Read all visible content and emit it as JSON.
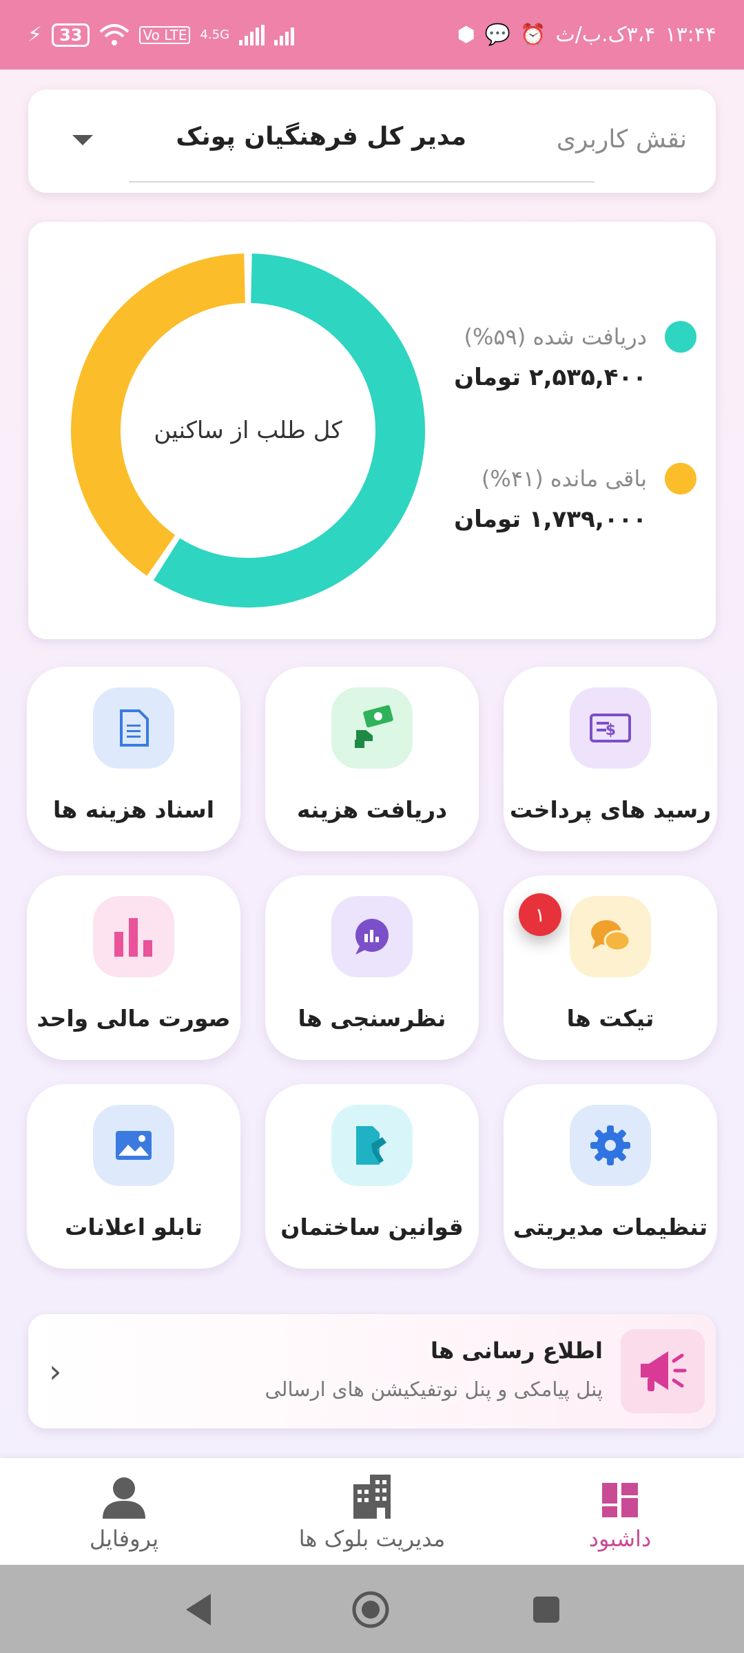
{
  "status_bar": {
    "time": "۱۳:۴۴",
    "date": "۳،۴ک.ب/ث",
    "battery": "33",
    "network": "4.5G",
    "volte": "Vo LTE"
  },
  "role": {
    "label": "نقش کاربری",
    "value": "مدیر کل فرهنگیان پونک"
  },
  "summary": {
    "center_label": "کل طلب از ساکنین",
    "items": [
      {
        "label": "دریافت شده (۵۹%)",
        "value": "۲,۵۳۵,۴۰۰ تومان",
        "color": "#2ed5c1"
      },
      {
        "label": "باقی مانده (۴۱%)",
        "value": "۱,۷۳۹,۰۰۰ تومان",
        "color": "#fbbd29"
      }
    ]
  },
  "chart_data": {
    "type": "pie",
    "title": "کل طلب از ساکنین",
    "categories": [
      "دریافت شده",
      "باقی مانده"
    ],
    "values": [
      2535400,
      1739000
    ],
    "percent": [
      59,
      41
    ],
    "colors": [
      "#2ed5c1",
      "#fbbd29"
    ]
  },
  "tiles": [
    {
      "label": "رسید های پرداخت",
      "icon": "payment-receipt-icon"
    },
    {
      "label": "دریافت هزینه",
      "icon": "cash-payment-icon"
    },
    {
      "label": "اسناد هزینه ها",
      "icon": "document-icon"
    },
    {
      "label": "تیکت ها",
      "icon": "chat-bubbles-icon",
      "badge": "۱"
    },
    {
      "label": "نظرسنجی ها",
      "icon": "poll-chat-icon"
    },
    {
      "label": "صورت مالی واحد",
      "icon": "bar-chart-icon"
    },
    {
      "label": "تنظیمات مدیریتی",
      "icon": "gear-icon"
    },
    {
      "label": "قوانین ساختمان",
      "icon": "building-rules-icon"
    },
    {
      "label": "تابلو اعلانات",
      "icon": "image-board-icon"
    }
  ],
  "notification": {
    "title": "اطلاع رسانی ها",
    "subtitle": "پنل پیامکی و پنل نوتفیکیشن های ارسالی"
  },
  "bottom_nav": {
    "items": [
      {
        "label": "داشبود",
        "icon": "dashboard-icon",
        "active": true
      },
      {
        "label": "مدیریت بلوک ها",
        "icon": "building-icon",
        "active": false
      },
      {
        "label": "پروفایل",
        "icon": "person-icon",
        "active": false
      }
    ],
    "active_color": "#c94b95"
  }
}
